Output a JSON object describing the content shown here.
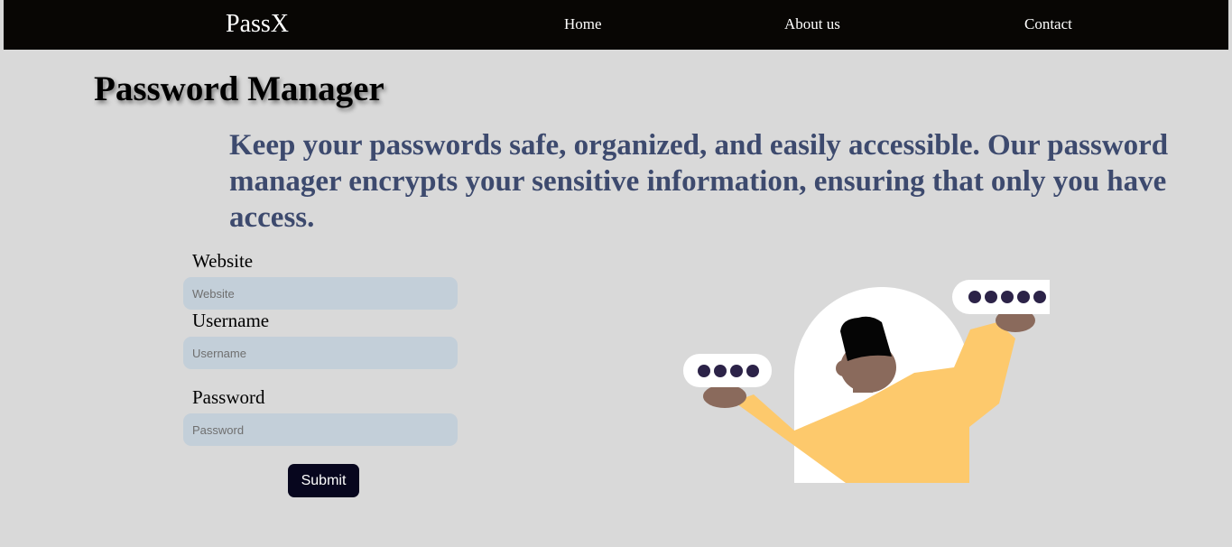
{
  "navbar": {
    "brand": "PassX",
    "links": [
      {
        "label": "Home"
      },
      {
        "label": "About us"
      },
      {
        "label": "Contact"
      }
    ]
  },
  "hero": {
    "title": "Password Manager",
    "tagline": "Keep your passwords safe, organized, and easily accessible. Our password manager encrypts your sensitive information, ensuring that only you have access."
  },
  "form": {
    "website": {
      "label": "Website",
      "placeholder": "Website",
      "value": ""
    },
    "username": {
      "label": "Username",
      "placeholder": "Username",
      "value": ""
    },
    "password": {
      "label": "Password",
      "placeholder": "Password",
      "value": ""
    },
    "submit_label": "Submit"
  },
  "illustration": {
    "icon": "person-holding-passwords-illustration",
    "left_mask": "••••",
    "right_mask": "•••••"
  },
  "colors": {
    "navbar_bg": "#080604",
    "page_bg": "#d9d9d9",
    "tagline": "#3d4a6e",
    "input_bg": "#c3cfd9",
    "button_bg": "#07061e",
    "sweater": "#fdc96c",
    "skin": "#8a6a5c"
  }
}
